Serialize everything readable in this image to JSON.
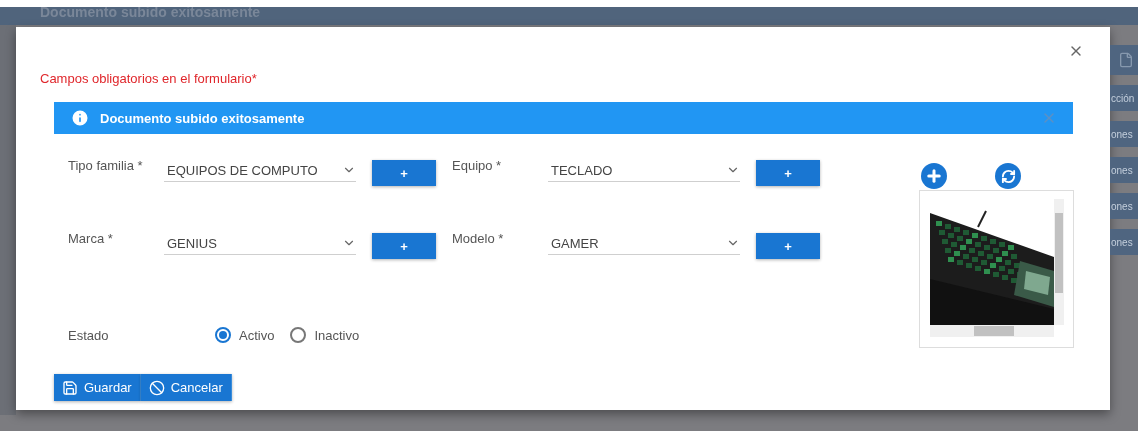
{
  "background": {
    "header_title": "Documento subido exitosamente",
    "side_texts": [
      "cción",
      "ones",
      "ones",
      "ones",
      "ones"
    ]
  },
  "modal": {
    "required_note": "Campos obligatorios en el formulario*",
    "alert": {
      "message": "Documento subido exitosamente"
    },
    "fields": [
      {
        "label": "Tipo familia *",
        "value": "EQUIPOS DE COMPUTO",
        "add_label": "+"
      },
      {
        "label": "Equipo *",
        "value": "TECLADO",
        "add_label": "+"
      },
      {
        "label": "Marca *",
        "value": "GENIUS",
        "add_label": "+"
      },
      {
        "label": "Modelo *",
        "value": "GAMER",
        "add_label": "+"
      }
    ],
    "estado": {
      "label": "Estado",
      "options": [
        {
          "label": "Activo",
          "selected": true
        },
        {
          "label": "Inactivo",
          "selected": false
        }
      ]
    },
    "buttons": [
      {
        "label": "Guardar",
        "kind": "save"
      },
      {
        "label": "Cancelar",
        "kind": "cancel"
      }
    ]
  }
}
